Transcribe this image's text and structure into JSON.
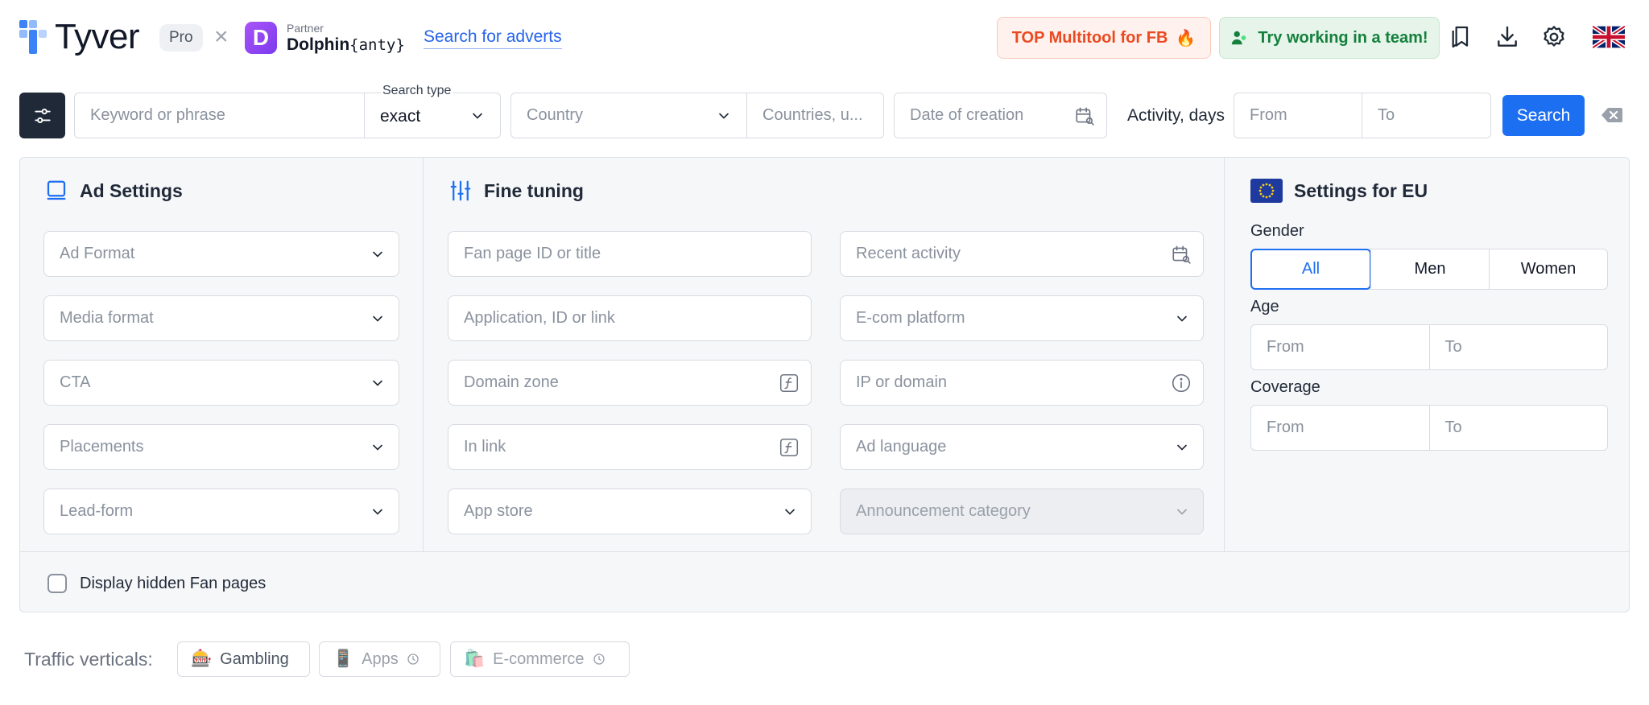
{
  "header": {
    "logo_text": "Tyver",
    "pro_badge": "Pro",
    "times_symbol": "×",
    "partner_logo_letter": "D",
    "partner_label": "Partner",
    "partner_name": "Dolphin",
    "partner_name_suffix": "{anty}",
    "search_adverts_link": "Search for adverts",
    "top_multitool_label": "TOP Multitool for FB",
    "try_team_label": "Try working in a team!",
    "icons": [
      "bookmarks-icon",
      "download-icon",
      "settings-icon",
      "uk-flag-icon"
    ]
  },
  "search_bar": {
    "keyword_placeholder": "Keyword or phrase",
    "search_type_label": "Search type",
    "search_type_value": "exact",
    "country_placeholder": "Country",
    "countries_placeholder": "Countries, u...",
    "date_placeholder": "Date of creation",
    "activity_label": "Activity, days",
    "from_placeholder": "From",
    "to_placeholder": "To",
    "search_button": "Search"
  },
  "ad_settings": {
    "title": "Ad Settings",
    "fields": [
      "Ad Format",
      "Media format",
      "CTA",
      "Placements",
      "Lead-form"
    ]
  },
  "fine_tuning": {
    "title": "Fine tuning",
    "left_fields": [
      "Fan page ID or title",
      "Application, ID or link",
      "Domain zone",
      "In link",
      "App store"
    ],
    "right_fields": [
      "Recent activity",
      "E-com platform",
      "IP or domain",
      "Ad language",
      "Announcement category"
    ]
  },
  "eu_settings": {
    "title": "Settings for EU",
    "gender_label": "Gender",
    "gender_options": [
      "All",
      "Men",
      "Women"
    ],
    "gender_selected": "All",
    "age_label": "Age",
    "coverage_label": "Coverage",
    "from_placeholder": "From",
    "to_placeholder": "To"
  },
  "display_hidden_label": "Display hidden Fan pages",
  "traffic_verticals": {
    "label": "Traffic verticals:",
    "chips": [
      {
        "label": "Gambling",
        "emoji": "🎰"
      },
      {
        "label": "Apps",
        "emoji": "📱"
      },
      {
        "label": "E-commerce",
        "emoji": "🛍️"
      }
    ]
  },
  "colors": {
    "accent": "#1d6ff2",
    "logo_blue": "#3b82f6",
    "multitool_text": "#ea4a21",
    "team_text": "#15803d",
    "dark_button": "#1f2937"
  }
}
